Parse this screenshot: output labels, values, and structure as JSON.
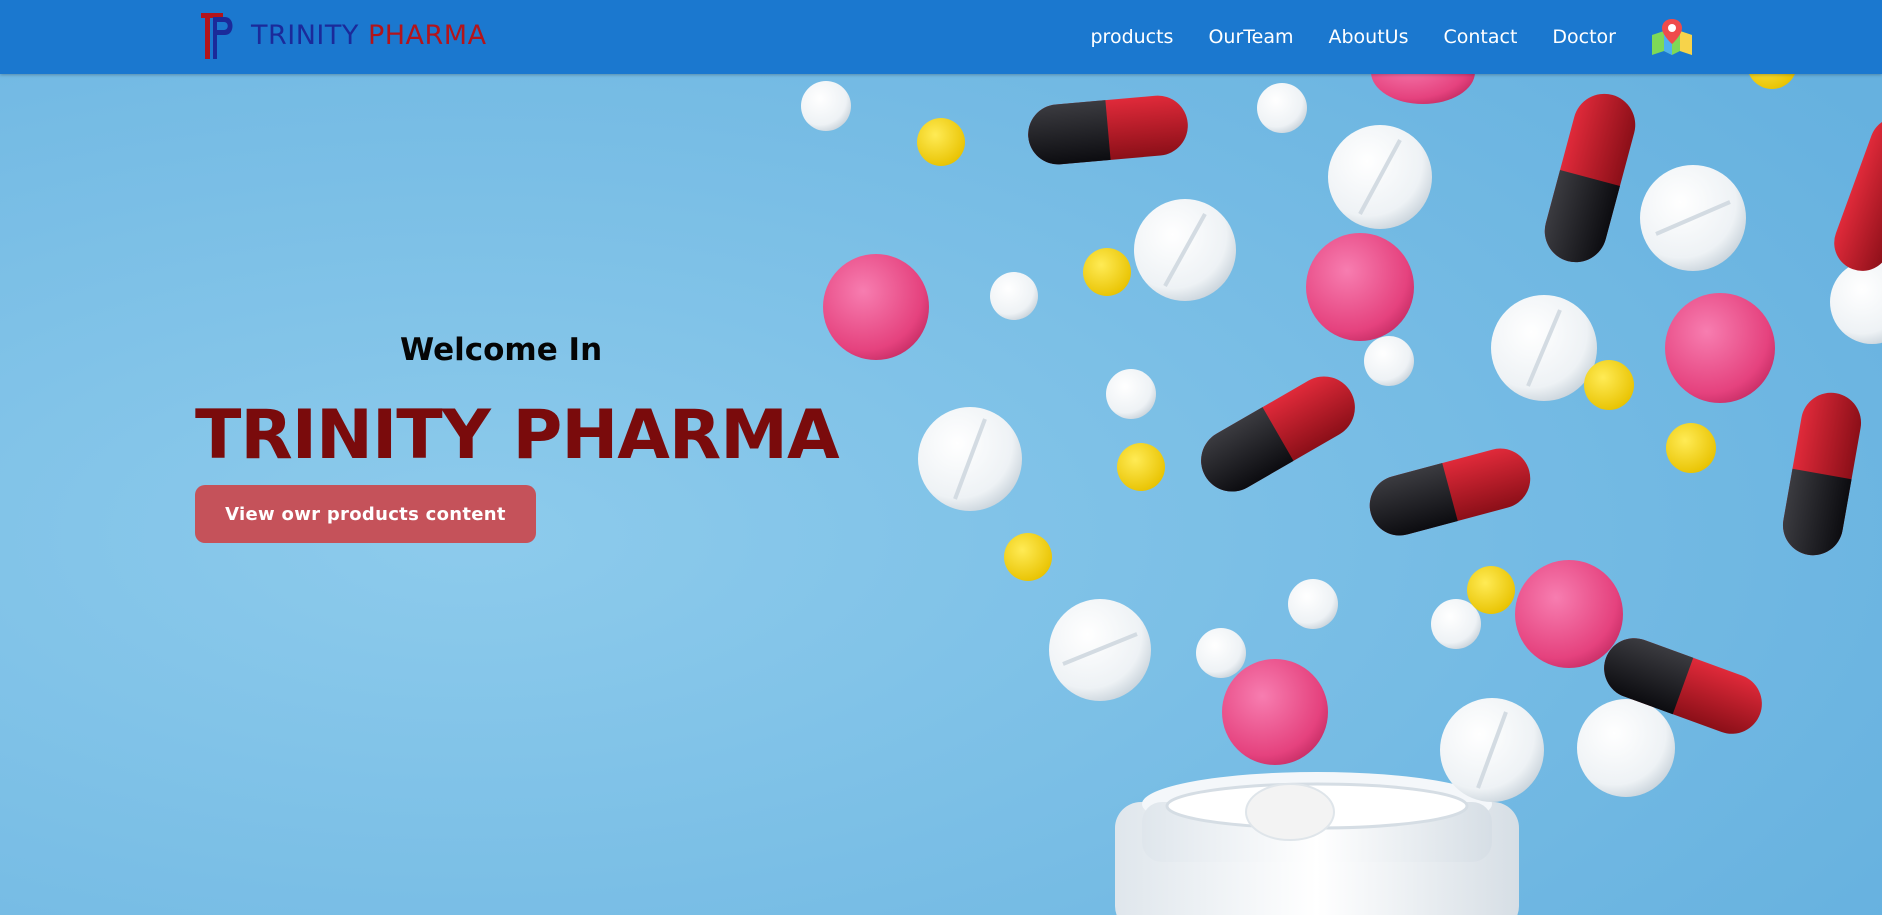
{
  "header": {
    "brand": {
      "word1": "TRINITY",
      "word2": "PHARMA",
      "logo_icon": "tp-monogram-logo"
    },
    "nav": [
      {
        "label": "products"
      },
      {
        "label": "OurTeam"
      },
      {
        "label": "AboutUs"
      },
      {
        "label": "Contact"
      },
      {
        "label": "Doctor"
      }
    ],
    "map_icon": "map-pin-icon"
  },
  "hero": {
    "welcome": "Welcome In",
    "title": "TRINITY PHARMA",
    "cta_label": "View owr products content",
    "background_image": "spilled-pills-and-capsules-photo"
  },
  "colors": {
    "header_bg": "#1b78cf",
    "brand_blue": "#1b2a9a",
    "brand_red": "#b3141b",
    "hero_bg": "#7cc0e6",
    "hero_title": "#7a0b0c",
    "cta_bg": "#c5525a",
    "nav_text": "#ffffff"
  }
}
